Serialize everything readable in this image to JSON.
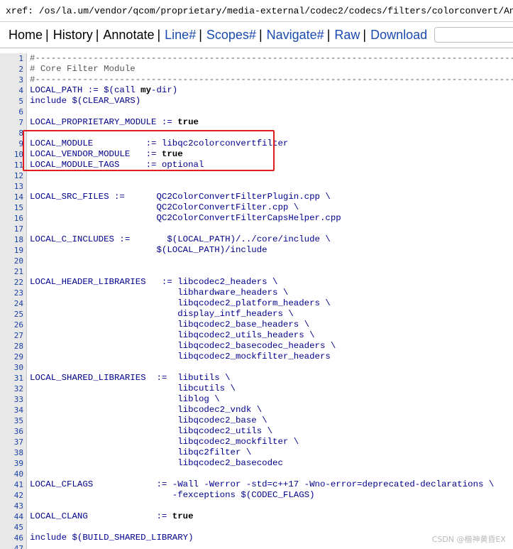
{
  "xref": {
    "label": "xref: /os/la.um/vendor/qcom/proprietary/media-external/codec2/codecs/filters/colorconvert/Android.mk"
  },
  "nav": {
    "items": [
      {
        "label": "Home",
        "color": "#000000"
      },
      {
        "label": "History",
        "color": "#000000"
      },
      {
        "label": "Annotate",
        "color": "#000000"
      },
      {
        "label": "Line#",
        "color": "#1a4bb0"
      },
      {
        "label": "Scopes#",
        "color": "#1a4bb0"
      },
      {
        "label": "Navigate#",
        "color": "#1a4bb0"
      },
      {
        "label": "Raw",
        "color": "#1a4bb0"
      },
      {
        "label": "Download",
        "color": "#1a4bb0"
      }
    ],
    "separator": "|",
    "search_placeholder": ""
  },
  "code": {
    "lines": [
      {
        "n": "1",
        "text": "#-------------------------------------------------------------------------------------------",
        "comment": true
      },
      {
        "n": "2",
        "text": "# Core Filter Module",
        "comment": true
      },
      {
        "n": "3",
        "text": "#-------------------------------------------------------------------------------------------",
        "comment": true
      },
      {
        "n": "4",
        "pre": "LOCAL_PATH := $(call ",
        "bold": "my",
        "post": "-dir)"
      },
      {
        "n": "5",
        "text": "include $(CLEAR_VARS)"
      },
      {
        "n": "6",
        "text": ""
      },
      {
        "n": "7",
        "pre": "LOCAL_PROPRIETARY_MODULE := ",
        "bold": "true",
        "post": ""
      },
      {
        "n": "8",
        "text": ""
      },
      {
        "n": "9",
        "text": "LOCAL_MODULE          := libqc2colorconvertfilter"
      },
      {
        "n": "10",
        "pre": "LOCAL_VENDOR_MODULE   := ",
        "bold": "true",
        "post": ""
      },
      {
        "n": "11",
        "text": "LOCAL_MODULE_TAGS     := optional"
      },
      {
        "n": "12",
        "text": ""
      },
      {
        "n": "13",
        "text": ""
      },
      {
        "n": "14",
        "text": "LOCAL_SRC_FILES :=      QC2ColorConvertFilterPlugin.cpp \\"
      },
      {
        "n": "15",
        "text": "                        QC2ColorConvertFilter.cpp \\"
      },
      {
        "n": "16",
        "text": "                        QC2ColorConvertFilterCapsHelper.cpp"
      },
      {
        "n": "17",
        "text": ""
      },
      {
        "n": "18",
        "text": "LOCAL_C_INCLUDES :=       $(LOCAL_PATH)/../core/include \\"
      },
      {
        "n": "19",
        "text": "                        $(LOCAL_PATH)/include"
      },
      {
        "n": "20",
        "text": ""
      },
      {
        "n": "21",
        "text": ""
      },
      {
        "n": "22",
        "text": "LOCAL_HEADER_LIBRARIES   := libcodec2_headers \\"
      },
      {
        "n": "23",
        "text": "                            libhardware_headers \\"
      },
      {
        "n": "24",
        "text": "                            libqcodec2_platform_headers \\"
      },
      {
        "n": "25",
        "text": "                            display_intf_headers \\"
      },
      {
        "n": "26",
        "text": "                            libqcodec2_base_headers \\"
      },
      {
        "n": "27",
        "text": "                            libqcodec2_utils_headers \\"
      },
      {
        "n": "28",
        "text": "                            libqcodec2_basecodec_headers \\"
      },
      {
        "n": "29",
        "text": "                            libqcodec2_mockfilter_headers"
      },
      {
        "n": "30",
        "text": ""
      },
      {
        "n": "31",
        "text": "LOCAL_SHARED_LIBRARIES  :=  libutils \\"
      },
      {
        "n": "32",
        "text": "                            libcutils \\"
      },
      {
        "n": "33",
        "text": "                            liblog \\"
      },
      {
        "n": "34",
        "text": "                            libcodec2_vndk \\"
      },
      {
        "n": "35",
        "text": "                            libqcodec2_base \\"
      },
      {
        "n": "36",
        "text": "                            libqcodec2_utils \\"
      },
      {
        "n": "37",
        "text": "                            libqcodec2_mockfilter \\"
      },
      {
        "n": "38",
        "text": "                            libqc2filter \\"
      },
      {
        "n": "39",
        "text": "                            libqcodec2_basecodec"
      },
      {
        "n": "40",
        "text": ""
      },
      {
        "n": "41",
        "text": "LOCAL_CFLAGS            := -Wall -Werror -std=c++17 -Wno-error=deprecated-declarations \\"
      },
      {
        "n": "42",
        "text": "                           -fexceptions $(CODEC_FLAGS)"
      },
      {
        "n": "43",
        "text": ""
      },
      {
        "n": "44",
        "pre": "LOCAL_CLANG             := ",
        "bold": "true",
        "post": ""
      },
      {
        "n": "45",
        "text": ""
      },
      {
        "n": "46",
        "text": "include $(BUILD_SHARED_LIBRARY)"
      },
      {
        "n": "47",
        "text": ""
      }
    ]
  },
  "watermark": {
    "text": "CSDN @楷神黄昏EX"
  },
  "colors": {
    "highlight_border": "#e01e1e",
    "link_blue": "#1a4bb0",
    "line_number_blue": "#1a3fa6",
    "gutter_bg": "#e8e8e8"
  }
}
